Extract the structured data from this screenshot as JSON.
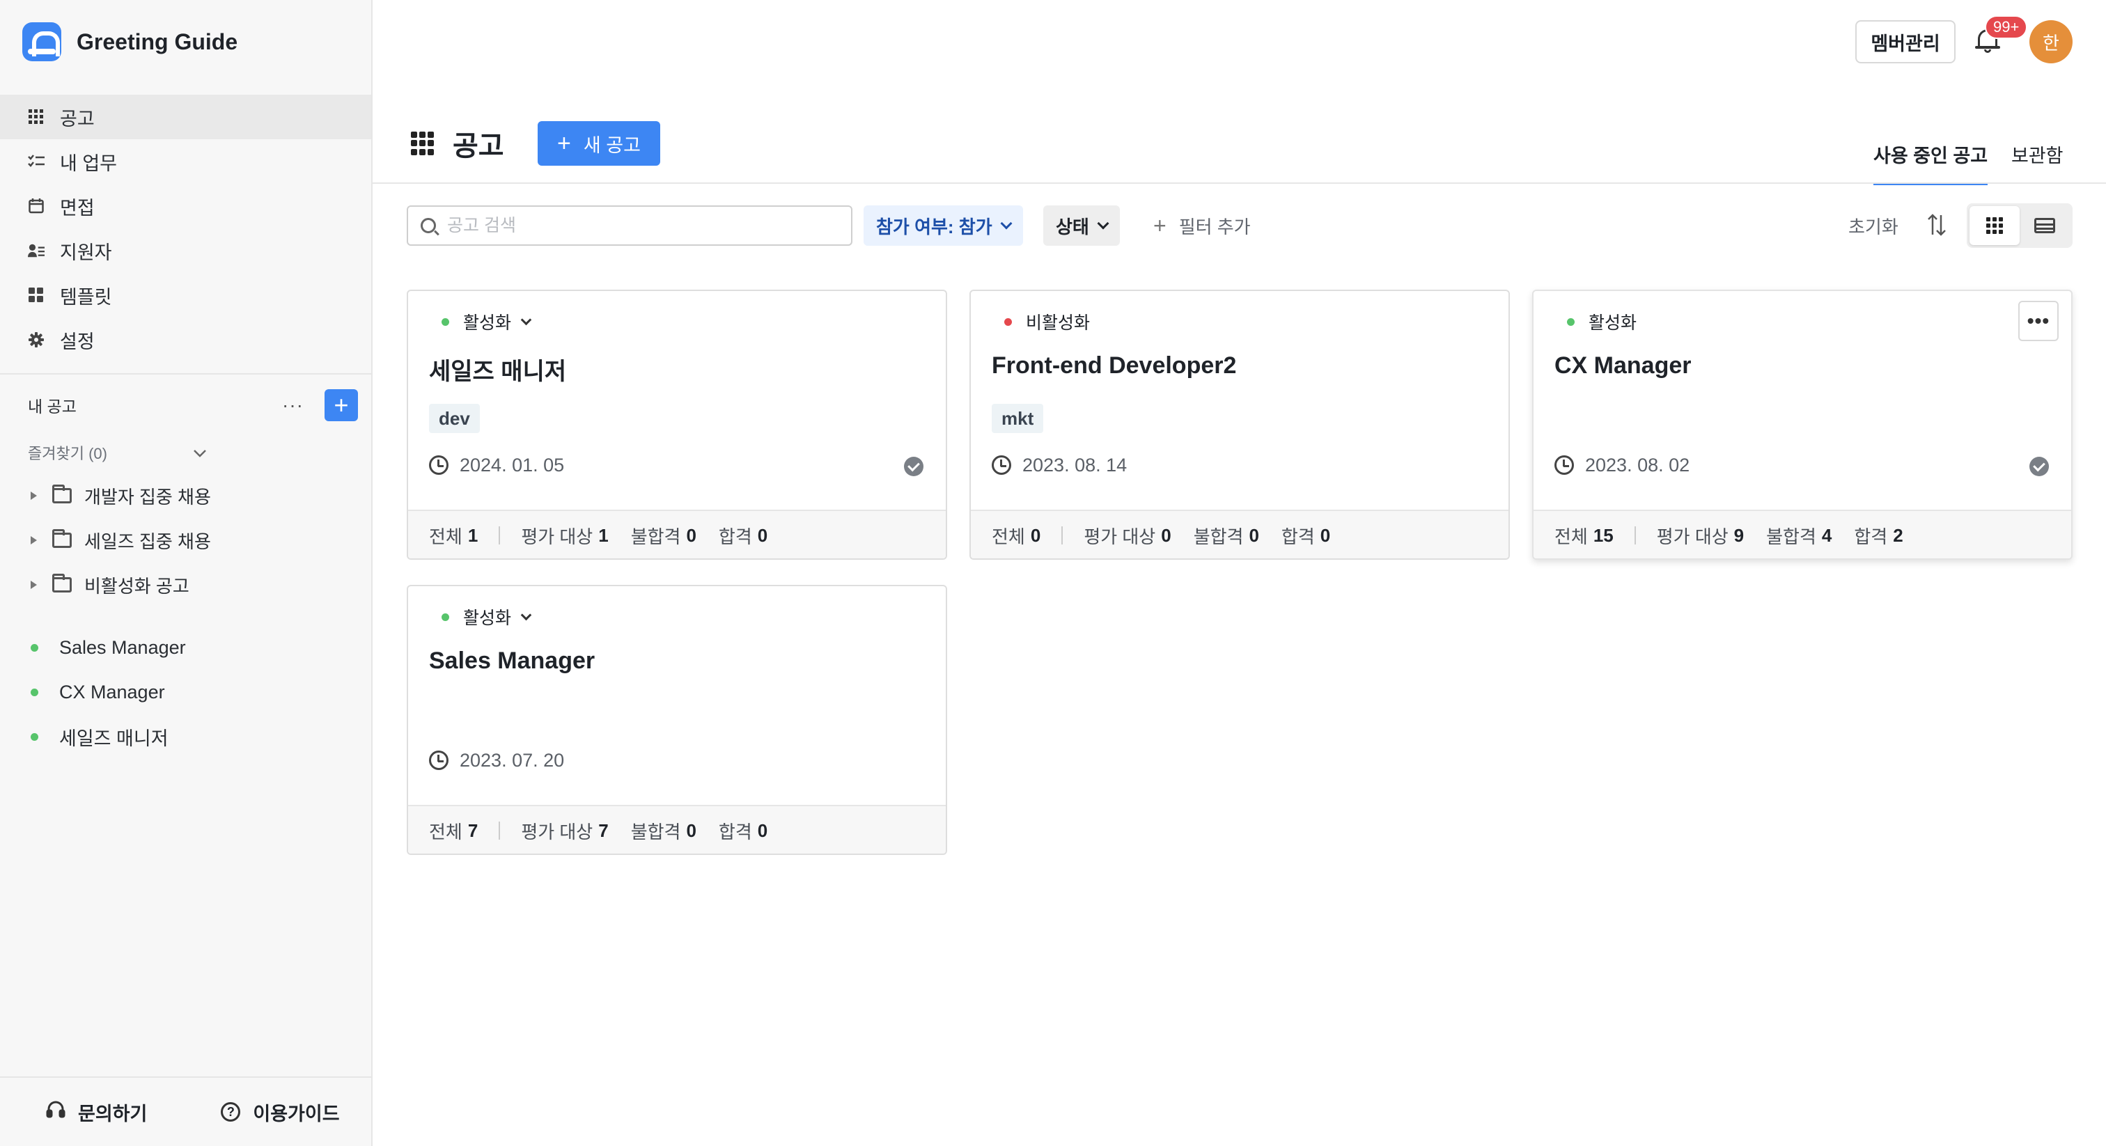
{
  "app": {
    "name": "Greeting Guide"
  },
  "sidebar": {
    "nav": [
      {
        "label": "공고",
        "icon": "grid-icon",
        "active": true
      },
      {
        "label": "내 업무",
        "icon": "checklist-icon"
      },
      {
        "label": "면접",
        "icon": "calendar-icon"
      },
      {
        "label": "지원자",
        "icon": "user-list-icon"
      },
      {
        "label": "템플릿",
        "icon": "template-icon"
      },
      {
        "label": "설정",
        "icon": "gear-icon"
      }
    ],
    "my_jobs_label": "내 공고",
    "more_label": "···",
    "add_label": "+",
    "favorites_label": "즐겨찾기 (0)",
    "folders": [
      "개발자 집중 채용",
      "세일즈 집중 채용",
      "비활성화 공고"
    ],
    "job_links": [
      "Sales Manager",
      "CX Manager",
      "세일즈 매니저"
    ],
    "bottom": {
      "contact": "문의하기",
      "guide": "이용가이드"
    }
  },
  "topbar": {
    "member_button": "멤버관리",
    "notification_badge": "99+",
    "avatar_initial": "한"
  },
  "header": {
    "title": "공고",
    "new_button": "새 공고",
    "tabs": [
      {
        "label": "사용 중인 공고",
        "active": true
      },
      {
        "label": "보관함",
        "active": false
      }
    ]
  },
  "filters": {
    "search_placeholder": "공고 검색",
    "participation_chip": "참가 여부: 참가",
    "status_chip": "상태",
    "add_filter": "필터 추가",
    "reset": "초기화",
    "view_mode": "grid"
  },
  "colors": {
    "accent": "#3d86f3",
    "active_dot": "#57c46b",
    "inactive_dot": "#e5484d"
  },
  "cards": [
    {
      "status": "활성화",
      "status_color": "#57c46b",
      "has_dropdown": true,
      "title": "세일즈 매니저",
      "tag": "dev",
      "date": "2024. 01. 05",
      "checked": true,
      "stats": {
        "total_label": "전체",
        "total": "1",
        "eval_label": "평가 대상",
        "eval": "1",
        "fail_label": "불합격",
        "fail": "0",
        "pass_label": "합격",
        "pass": "0"
      }
    },
    {
      "status": "비활성화",
      "status_color": "#e5484d",
      "has_dropdown": false,
      "title": "Front-end Developer2",
      "tag": "mkt",
      "date": "2023. 08. 14",
      "checked": false,
      "stats": {
        "total_label": "전체",
        "total": "0",
        "eval_label": "평가 대상",
        "eval": "0",
        "fail_label": "불합격",
        "fail": "0",
        "pass_label": "합격",
        "pass": "0"
      }
    },
    {
      "status": "활성화",
      "status_color": "#57c46b",
      "has_dropdown": false,
      "title": "CX Manager",
      "tag": "",
      "date": "2023. 08. 02",
      "checked": true,
      "more": "•••",
      "stats": {
        "total_label": "전체",
        "total": "15",
        "eval_label": "평가 대상",
        "eval": "9",
        "fail_label": "불합격",
        "fail": "4",
        "pass_label": "합격",
        "pass": "2"
      }
    },
    {
      "status": "활성화",
      "status_color": "#57c46b",
      "has_dropdown": true,
      "title": "Sales Manager",
      "tag": "",
      "date": "2023. 07. 20",
      "checked": false,
      "stats": {
        "total_label": "전체",
        "total": "7",
        "eval_label": "평가 대상",
        "eval": "7",
        "fail_label": "불합격",
        "fail": "0",
        "pass_label": "합격",
        "pass": "0"
      }
    }
  ]
}
